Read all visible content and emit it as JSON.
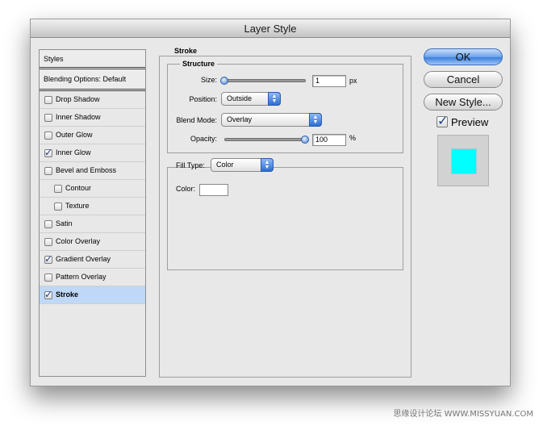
{
  "window": {
    "title": "Layer Style"
  },
  "styles_panel": {
    "header": "Styles",
    "blending_options": "Blending Options: Default",
    "items": [
      {
        "label": "Drop Shadow",
        "checked": false,
        "sub": false,
        "selected": false
      },
      {
        "label": "Inner Shadow",
        "checked": false,
        "sub": false,
        "selected": false
      },
      {
        "label": "Outer Glow",
        "checked": false,
        "sub": false,
        "selected": false
      },
      {
        "label": "Inner Glow",
        "checked": true,
        "sub": false,
        "selected": false
      },
      {
        "label": "Bevel and Emboss",
        "checked": false,
        "sub": false,
        "selected": false
      },
      {
        "label": "Contour",
        "checked": false,
        "sub": true,
        "selected": false
      },
      {
        "label": "Texture",
        "checked": false,
        "sub": true,
        "selected": false
      },
      {
        "label": "Satin",
        "checked": false,
        "sub": false,
        "selected": false
      },
      {
        "label": "Color Overlay",
        "checked": false,
        "sub": false,
        "selected": false
      },
      {
        "label": "Gradient Overlay",
        "checked": true,
        "sub": false,
        "selected": false
      },
      {
        "label": "Pattern Overlay",
        "checked": false,
        "sub": false,
        "selected": false
      },
      {
        "label": "Stroke",
        "checked": true,
        "sub": false,
        "selected": true
      }
    ]
  },
  "stroke": {
    "section_title": "Stroke",
    "structure_title": "Structure",
    "size_label": "Size:",
    "size_value": "1",
    "size_unit": "px",
    "position_label": "Position:",
    "position_value": "Outside",
    "blend_mode_label": "Blend Mode:",
    "blend_mode_value": "Overlay",
    "opacity_label": "Opacity:",
    "opacity_value": "100",
    "opacity_unit": "%",
    "fill_type_label": "Fill Type:",
    "fill_type_value": "Color",
    "color_label": "Color:",
    "color_value": "#ffffff"
  },
  "buttons": {
    "ok": "OK",
    "cancel": "Cancel",
    "new_style": "New Style..."
  },
  "preview": {
    "label": "Preview",
    "checked": true,
    "swatch_color": "#00ffff"
  },
  "watermark": "思缘设计论坛 WWW.MISSYUAN.COM"
}
